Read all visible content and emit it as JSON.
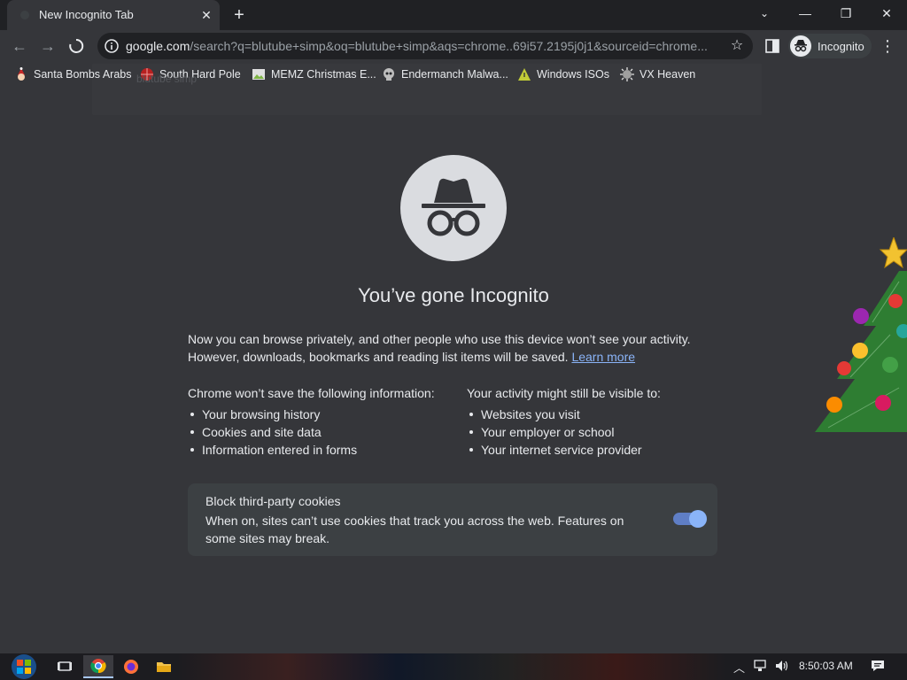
{
  "window": {
    "tab_title": "New Incognito Tab",
    "minimize": "—",
    "restore": "❐",
    "close": "✕"
  },
  "toolbar": {
    "url_host": "google.com",
    "url_rest": "/search?q=blutube+simp&oq=blutube+simp&aqs=chrome..69i57.2195j0j1&sourceid=chrome...",
    "profile_label": "Incognito"
  },
  "bookmarks": [
    {
      "label": "Santa Bombs Arabs",
      "icon": "santa-icon"
    },
    {
      "label": "South Hard Pole",
      "icon": "globe-icon"
    },
    {
      "label": "MEMZ Christmas E...",
      "icon": "image-icon"
    },
    {
      "label": "Endermanch Malwa...",
      "icon": "skull-icon"
    },
    {
      "label": "Windows ISOs",
      "icon": "warning-icon"
    },
    {
      "label": "VX Heaven",
      "icon": "virus-icon"
    }
  ],
  "ghost_text": "blutube simp",
  "page": {
    "heading": "You’ve gone Incognito",
    "intro": "Now you can browse privately, and other people who use this device won’t see your activity. However, downloads, bookmarks and reading list items will be saved.",
    "learn_more": "Learn more",
    "left_col": {
      "title": "Chrome won’t save the following information:",
      "items": [
        "Your browsing history",
        "Cookies and site data",
        "Information entered in forms"
      ]
    },
    "right_col": {
      "title": "Your activity might still be visible to:",
      "items": [
        "Websites you visit",
        "Your employer or school",
        "Your internet service provider"
      ]
    },
    "cookies": {
      "title": "Block third-party cookies",
      "description": "When on, sites can’t use cookies that track you across the web. Features on some sites may break.",
      "enabled": true
    }
  },
  "taskbar": {
    "clock": "8:50:03 AM"
  },
  "colors": {
    "background": "#35363a",
    "tabstrip": "#202124",
    "link": "#8ab4f8",
    "toggle_on": "#8ab4f8"
  }
}
